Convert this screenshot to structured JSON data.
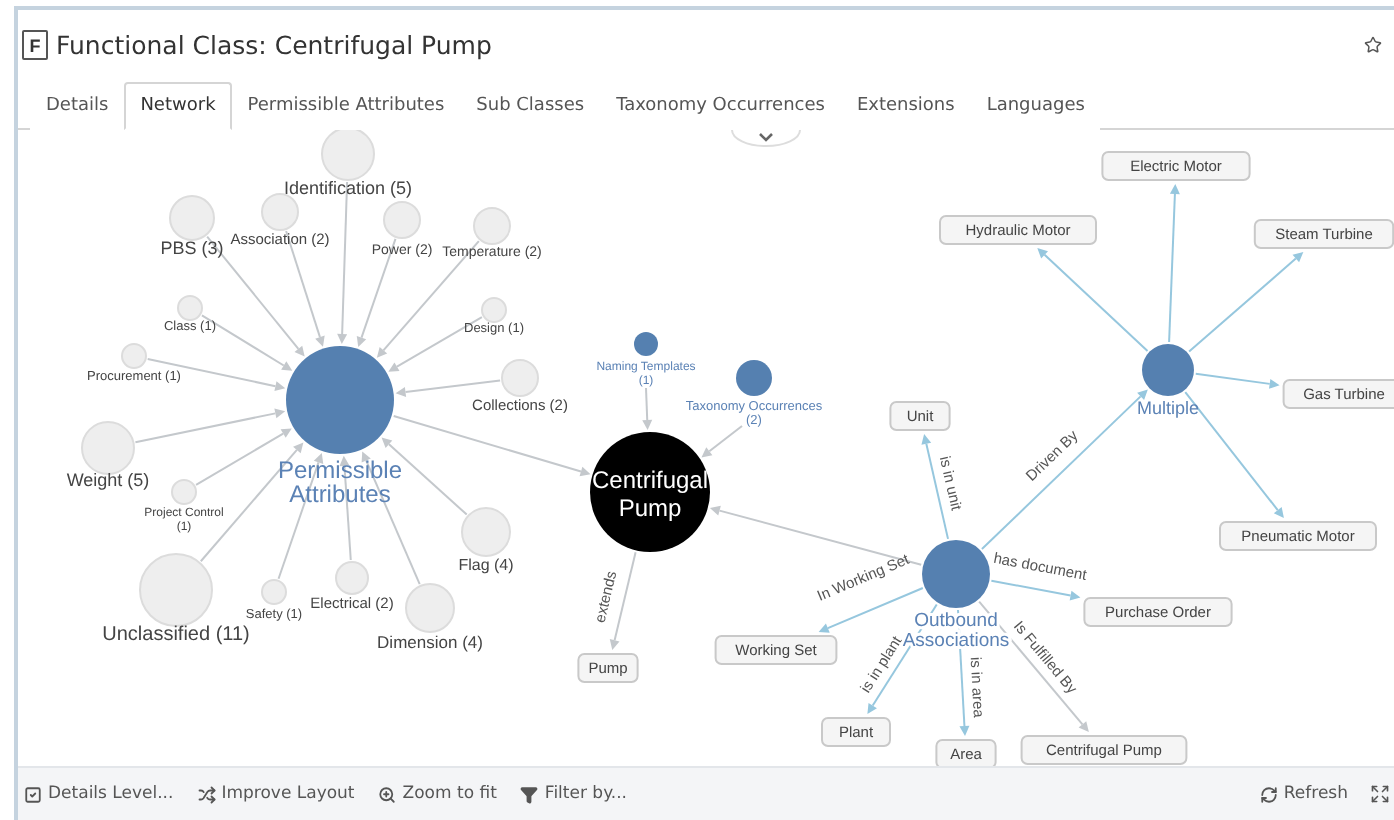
{
  "header": {
    "icon_letter": "F",
    "title": "Functional Class: Centrifugal Pump"
  },
  "tabs": [
    {
      "label": "Details",
      "selected": false
    },
    {
      "label": "Network",
      "selected": true
    },
    {
      "label": "Permissible Attributes",
      "selected": false
    },
    {
      "label": "Sub Classes",
      "selected": false
    },
    {
      "label": "Taxonomy Occurrences",
      "selected": false
    },
    {
      "label": "Extensions",
      "selected": false
    },
    {
      "label": "Languages",
      "selected": false
    }
  ],
  "network": {
    "center": {
      "label": "Centrifugal Pump"
    },
    "attributes_hub": {
      "label": "Permissible Attributes",
      "children": [
        "Identification (5)",
        "PBS (3)",
        "Association (2)",
        "Power (2)",
        "Temperature (2)",
        "Class (1)",
        "Design (1)",
        "Procurement (1)",
        "Collections (2)",
        "Weight (5)",
        "Project Control (1)",
        "Flag (4)",
        "Unclassified (11)",
        "Safety (1)",
        "Electrical (2)",
        "Dimension (4)"
      ]
    },
    "related": [
      "Naming Templates (1)",
      "Taxonomy Occurrences (2)"
    ],
    "extends": {
      "edge": "extends",
      "target": "Pump"
    },
    "outbound_hub": {
      "label": "Outbound Associations",
      "links": [
        {
          "edge": "is in unit",
          "target": "Unit"
        },
        {
          "edge": "has document",
          "target": "Purchase Order"
        },
        {
          "edge": "In Working Set",
          "target": "Working Set"
        },
        {
          "edge": "is in plant",
          "target": "Plant"
        },
        {
          "edge": "is in area",
          "target": "Area"
        },
        {
          "edge": "Is Fulfilled By",
          "target": "Centrifugal Pump"
        }
      ]
    },
    "multiple_hub": {
      "label": "Multiple",
      "edge": "Driven By",
      "targets": [
        "Electric Motor",
        "Hydraulic Motor",
        "Steam Turbine",
        "Gas Turbine",
        "Pneumatic Motor"
      ]
    }
  },
  "toolbar": {
    "left": [
      {
        "kind": "details",
        "label": "Details Level..."
      },
      {
        "kind": "layout",
        "label": "Improve Layout"
      },
      {
        "kind": "zoom",
        "label": "Zoom to fit"
      },
      {
        "kind": "filter",
        "label": "Filter by..."
      }
    ],
    "right": [
      {
        "kind": "refresh",
        "label": "Refresh"
      }
    ]
  }
}
